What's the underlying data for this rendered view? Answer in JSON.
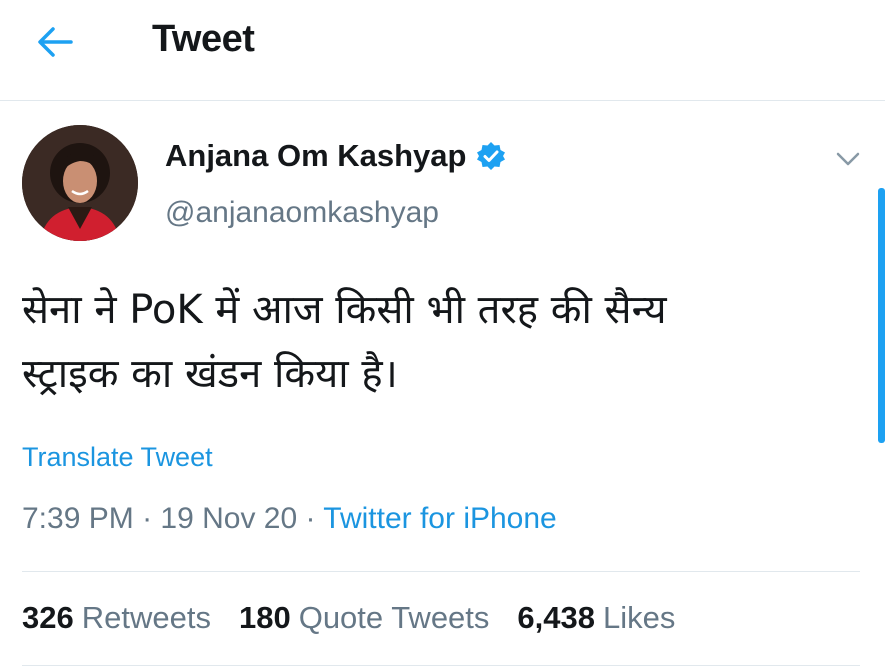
{
  "header": {
    "title": "Tweet",
    "back_icon": "arrow-left-icon",
    "accent_color": "#1da1f2"
  },
  "tweet": {
    "author": {
      "display_name": "Anjana Om Kashyap",
      "handle": "@anjanaomkashyap",
      "verified": true,
      "verified_icon": "verified-badge-icon"
    },
    "text_line_1": "सेना ने PoK में आज किसी भी तरह की सैन्य",
    "text_line_2": "स्ट्राइक का खंडन किया है।",
    "translate_label": "Translate Tweet",
    "time": "7:39 PM",
    "separator": " · ",
    "date": "19 Nov 20",
    "source": "Twitter for iPhone",
    "link_color": "#1b95e0"
  },
  "stats": {
    "retweets_count": "326",
    "retweets_label": "Retweets",
    "quote_tweets_count": "180",
    "quote_tweets_label": "Quote Tweets",
    "likes_count": "6,438",
    "likes_label": "Likes"
  }
}
